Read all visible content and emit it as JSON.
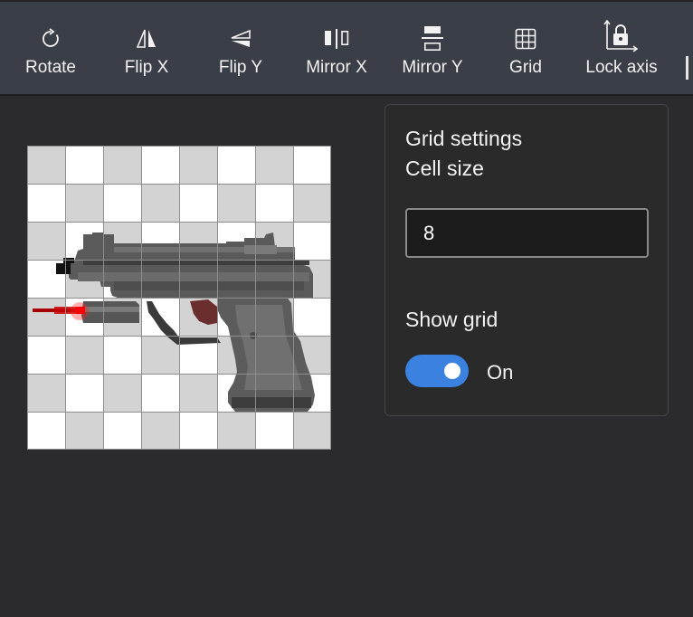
{
  "toolbar": {
    "rotate_label": "Rotate",
    "rotate_icon": "rotate-icon",
    "flipx_label": "Flip X",
    "flipx_icon": "flip-x-icon",
    "flipy_label": "Flip Y",
    "flipy_icon": "flip-y-icon",
    "mirrorx_label": "Mirror X",
    "mirrorx_icon": "mirror-x-icon",
    "mirrory_label": "Mirror Y",
    "mirrory_icon": "mirror-y-icon",
    "grid_label": "Grid",
    "grid_icon": "grid-icon",
    "lockaxis_label": "Lock axis",
    "lockaxis_icon": "lock-axis-icon"
  },
  "canvas": {
    "grid_cells": 8,
    "sprite": "pixel-art laser pistol"
  },
  "grid_settings": {
    "title": "Grid settings",
    "cell_size_label": "Cell size",
    "cell_size_value": "8",
    "show_grid_label": "Show grid",
    "show_grid_on": true,
    "show_grid_state": "On"
  },
  "colors": {
    "toolbar_bg": "#3a3f47",
    "workspace_bg": "#2b2b2d",
    "accent": "#3b82e0"
  }
}
